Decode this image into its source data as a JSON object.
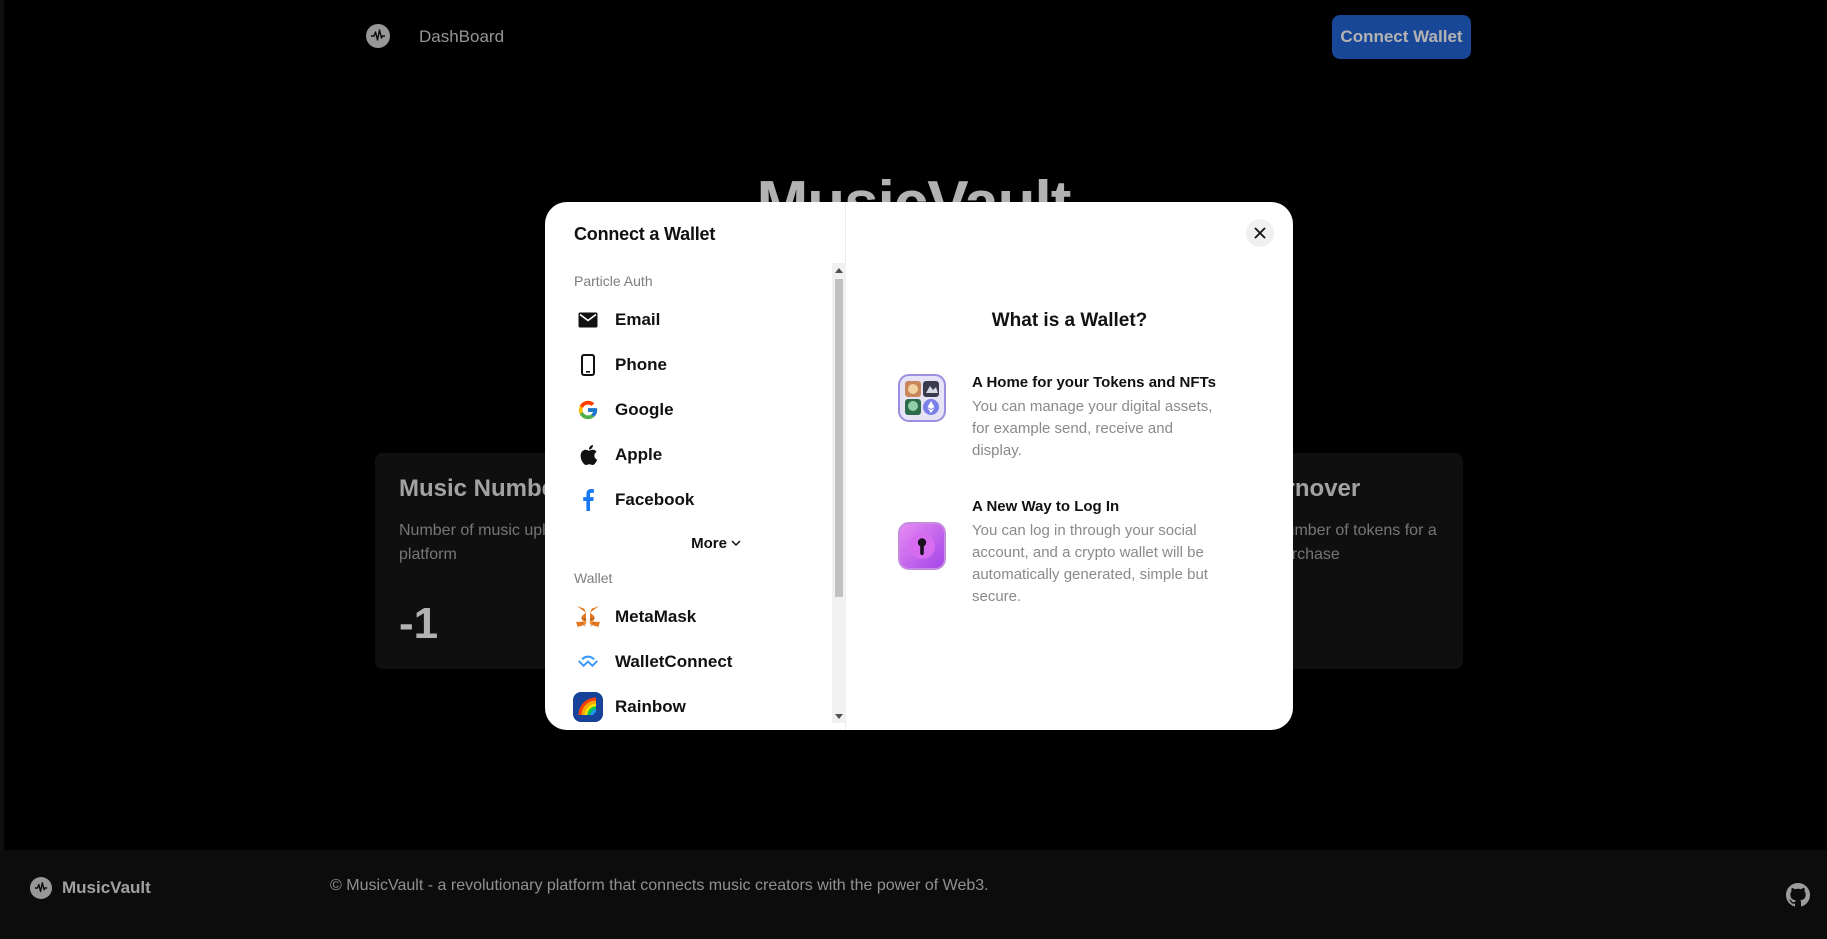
{
  "nav": {
    "logo_icon": "waveform-icon",
    "dashboard_link": "DashBoard",
    "connect_button": "Connect Wallet",
    "accent_color": "#2466d8"
  },
  "hero": {
    "title": "MusicVault"
  },
  "cards": [
    {
      "title": "Music Number",
      "description": "Number of music uploaded onto the platform",
      "value": "-1"
    },
    {
      "title": "Turnover",
      "description": "Number of tokens for a purchase"
    }
  ],
  "footer": {
    "brand": "MusicVault",
    "text": "© MusicVault - a revolutionary platform that connects music creators with the power of Web3.",
    "github_icon": "github-icon"
  },
  "modal": {
    "title": "Connect a Wallet",
    "close_icon": "close-icon",
    "groups": [
      {
        "label": "Particle Auth",
        "items": [
          {
            "label": "Email",
            "icon": "envelope-icon"
          },
          {
            "label": "Phone",
            "icon": "phone-icon"
          },
          {
            "label": "Google",
            "icon": "google-icon"
          },
          {
            "label": "Apple",
            "icon": "apple-icon"
          },
          {
            "label": "Facebook",
            "icon": "facebook-icon"
          }
        ],
        "more_label": "More"
      },
      {
        "label": "Wallet",
        "items": [
          {
            "label": "MetaMask",
            "icon": "metamask-icon"
          },
          {
            "label": "WalletConnect",
            "icon": "walletconnect-icon"
          },
          {
            "label": "Rainbow",
            "icon": "rainbow-icon"
          }
        ]
      }
    ],
    "info": {
      "title": "What is a Wallet?",
      "features": [
        {
          "heading": "A Home for your Tokens and NFTs",
          "body": "You can manage your digital assets, for example send, receive and display.",
          "icon": "nft-collection-icon"
        },
        {
          "heading": "A New Way to Log In",
          "body": "You can log in through your social account, and a crypto wallet will be automatically generated, simple but secure.",
          "icon": "keyhole-icon"
        }
      ]
    }
  }
}
